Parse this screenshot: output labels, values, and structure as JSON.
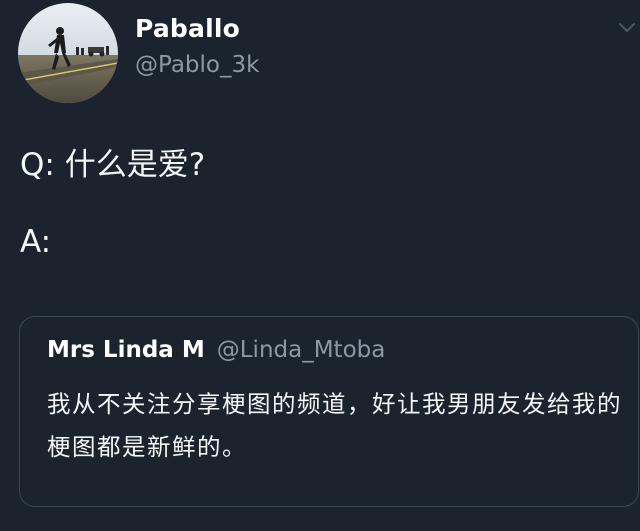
{
  "tweet": {
    "author": {
      "display_name": "Paballo",
      "handle": "@Pablo_3k",
      "avatar_icon": "profile-photo"
    },
    "question": "Q:  什么是爱?",
    "answer": "A:",
    "menu_icon": "chevron-down-icon",
    "quoted_tweet": {
      "display_name": "Mrs Linda  M",
      "handle": "@Linda_Mtoba",
      "text": "我从不关注分享梗图的频道，好让我男朋友发给我的梗图都是新鲜的。"
    }
  },
  "colors": {
    "background": "#1b232e",
    "text_primary": "#f3f5f7",
    "text_secondary": "#8d98a5",
    "card_border": "#3d4856"
  }
}
